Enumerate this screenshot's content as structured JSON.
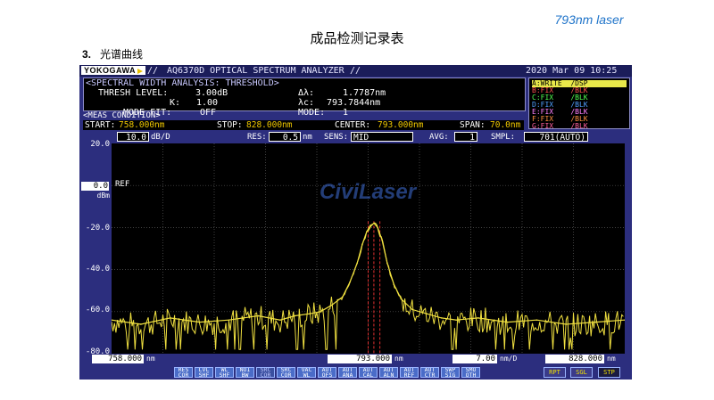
{
  "tag": "793nm laser",
  "doc_title": "成品检测记录表",
  "section": {
    "number": "3.",
    "title": "光谱曲线"
  },
  "osa": {
    "brand": "YOKOGAWA",
    "model": "AQ6370D OPTICAL SPECTRUM ANALYZER",
    "datetime": "2020 Mar 09 10:25",
    "analysis_header": "<SPECTRAL WIDTH ANALYSIS: THRESHOLD>",
    "thresh_label": "THRESH LEVEL:",
    "thresh_value": "3.00dB",
    "k_label": "K:",
    "k_value": "1.00",
    "fit_label": "MODE FIT:",
    "fit_value": "OFF",
    "dl_label": "Δλ:",
    "dl_value": "1.7787nm",
    "lc_label": "λc:",
    "lc_value": "793.7844nm",
    "mode_label": "MODE:",
    "mode_value": "1",
    "traces": [
      "A:WRITE  /DSP",
      "B:FIX    /BLK",
      "C:FIX    /BLK",
      "D:FIX    /BLK",
      "E:FIX    /BLK",
      "F:FIX    /BLK",
      "G:FIX    /BLK"
    ],
    "meas_label": "<MEAS CONDITION>",
    "start_label": "START:",
    "start_value": "758.000nm",
    "stop_label": "STOP:",
    "stop_value": "828.000nm",
    "center_label": "CENTER:",
    "center_value": "793.000nm",
    "span_label": "SPAN:",
    "span_value": "70.0nm",
    "scale_value": "10.0",
    "scale_unit": "dB/D",
    "res_label": "RES:",
    "res_value": "0.5",
    "res_unit": "nm",
    "sens_label": "SENS:",
    "sens_value": "MID",
    "avg_label": "AVG:",
    "avg_value": "1",
    "smpl_label": "SMPL:",
    "smpl_value": "701(AUTO)",
    "ref_value": "0.0",
    "ref_unit": "dBm",
    "ref_label": "REF",
    "y_ticks": [
      "20.0",
      "0.0",
      "-20.0",
      "-40.0",
      "-60.0",
      "-80.0"
    ],
    "x_start": "758.000",
    "x_center": "793.000",
    "x_per_div": "7.00",
    "x_per_div_unit": "nm/D",
    "x_stop": "828.000",
    "x_unit": "nm",
    "watermark": "CiviLaser",
    "softkeys": [
      "RES\nCOR",
      "LVL\nSHF",
      "WL\nSHF",
      "NOI\nBW",
      "SRC\nCOR",
      "SRC\nCOR",
      "VAC\nWL",
      "AUT\nOFS",
      "AUT\nANA",
      "AUT\nCAL",
      "AUT\nALN",
      "AUT\nREF",
      "AUT\nCTR",
      "SWP\nSIG",
      "SMO\nOTH"
    ],
    "action_keys": [
      "RPT",
      "SGL",
      "STP"
    ],
    "colors": {
      "trace": "#f0e040",
      "marker": "#e03030",
      "panel": "#2c2e7e",
      "grid": "#5a5a5a"
    }
  },
  "chart_data": {
    "type": "line",
    "title": "",
    "xlabel": "",
    "ylabel": "",
    "xlim": [
      758,
      828
    ],
    "ylim": [
      -80,
      20
    ],
    "grid": true,
    "series": [
      {
        "x": [
          758,
          762,
          766,
          770,
          774,
          778,
          781,
          783,
          785,
          786.5,
          788,
          789.5,
          790.5,
          791.5,
          792.2,
          792.8,
          793.3,
          793.8,
          794.3,
          794.9,
          795.6,
          796.5,
          797.5,
          799,
          801,
          803,
          805,
          808,
          812,
          816,
          820,
          824,
          828
        ],
        "y": [
          -64,
          -66,
          -63,
          -65,
          -64,
          -62,
          -64,
          -62,
          -61,
          -60,
          -57,
          -53,
          -46,
          -37,
          -28,
          -22,
          -19,
          -18,
          -20,
          -26,
          -37,
          -47,
          -54,
          -59,
          -61,
          -63,
          -64,
          -63,
          -65,
          -64,
          -66,
          -65,
          -64
        ]
      }
    ],
    "markers_x": [
      793.0,
      793.78,
      794.6
    ]
  }
}
